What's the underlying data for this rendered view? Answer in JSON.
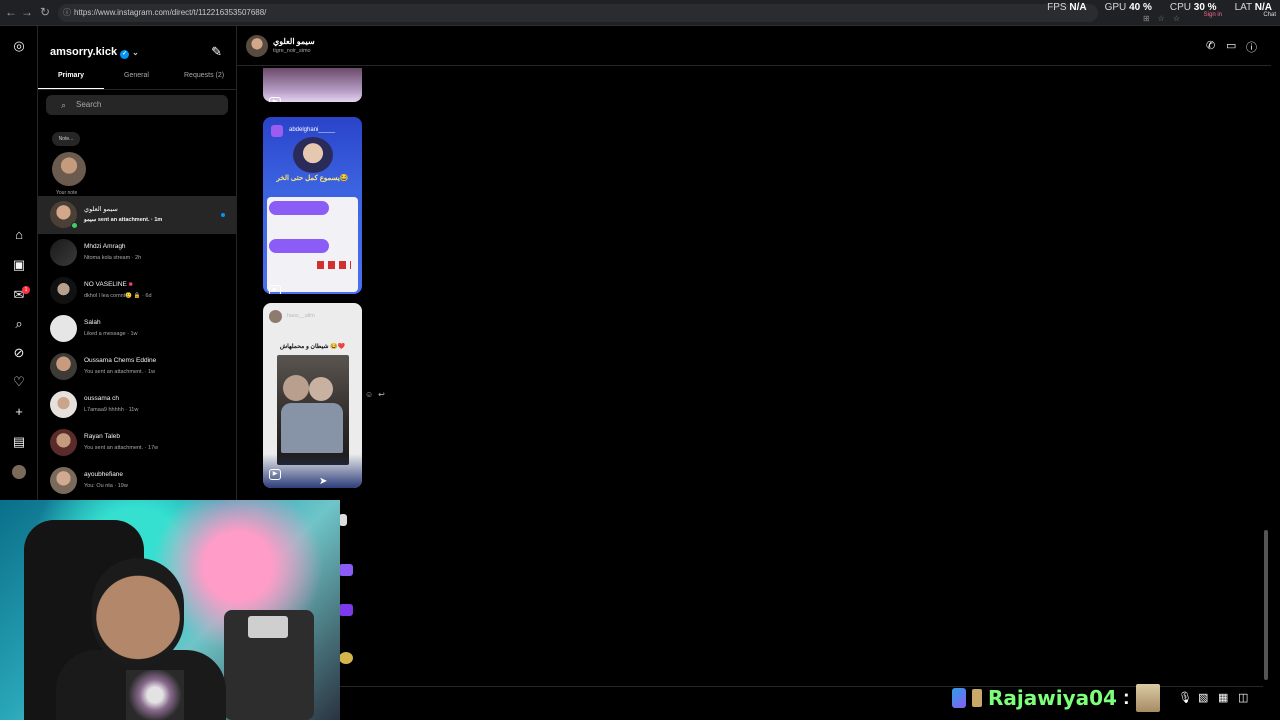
{
  "browser": {
    "url": "https://www.instagram.com/direct/t/112216353507688/",
    "stats": [
      {
        "label": "FPS",
        "value": "N/A"
      },
      {
        "label": "GPU",
        "value": "40 %"
      },
      {
        "label": "CPU",
        "value": "30 %"
      },
      {
        "label": "LAT",
        "value": "N/A"
      }
    ],
    "signin_label": "Sign in",
    "chat_label": "Chat"
  },
  "inbox": {
    "account": "amsorry.kick",
    "tabs": {
      "primary": "Primary",
      "general": "General",
      "requests": "Requests (2)"
    },
    "search_placeholder": "Search",
    "note": {
      "bubble": "Note...",
      "label": "Your note"
    },
    "conversations": [
      {
        "name": "سيمو العلوي",
        "preview": "سيمو sent an attachment. · 1m",
        "active": true,
        "online": true,
        "unread": true
      },
      {
        "name": "Mhdzi Amragh",
        "preview": "Ntoma kola stream · 2h"
      },
      {
        "name": "NO VASELINE",
        "preview": "dkhol l lea comnt🥲 🔒 · 6d"
      },
      {
        "name": "Salah",
        "preview": "Liked a message · 1w"
      },
      {
        "name": "Oussama Chems Eddine",
        "preview": "You sent an attachment. · 1w"
      },
      {
        "name": "oussama ch",
        "preview": "L7amaa9 hhhhh · 11w"
      },
      {
        "name": "Rayan Taleb",
        "preview": "You sent an attachment. · 17w"
      },
      {
        "name": "ayoubhefiane",
        "preview": "You: Ou nta · 19w"
      }
    ]
  },
  "chat": {
    "name": "سيمو العلوي",
    "username": "tigre_noir_simo",
    "media": [
      {
        "username": "abdelghani_____",
        "caption": "يسموع كمل حتى الخر😂"
      },
      {
        "username": "hass__allm",
        "caption": "شيطان و محملهاش 😂❤️"
      }
    ]
  },
  "stream": {
    "sub_name": "Rajawiya04",
    "sub_colon": ":"
  },
  "colors": {
    "accent": "#0095f6",
    "online": "#3fce6b",
    "notification": "#ff3040",
    "sub_text": "#7dff7a"
  }
}
